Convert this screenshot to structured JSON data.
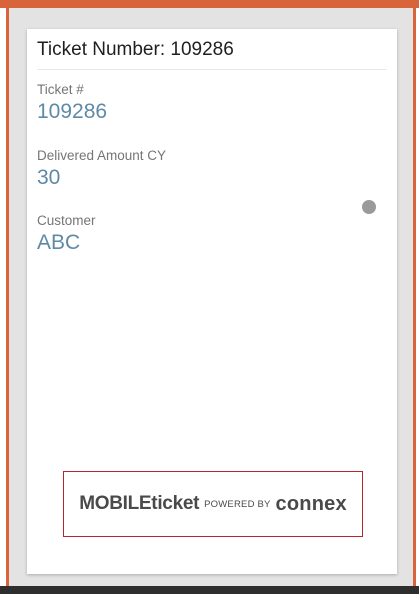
{
  "card": {
    "title": "Ticket Number: 109286"
  },
  "fields": [
    {
      "label": "Ticket #",
      "value": "109286"
    },
    {
      "label": "Delivered Amount CY",
      "value": "30"
    },
    {
      "label": "Customer",
      "value": "ABC"
    }
  ],
  "logo": {
    "product": "MOBILEticket",
    "powered_by": "POWERED BY",
    "brand": "connex"
  },
  "colors": {
    "accent_border": "#d9643c",
    "value_text": "#5e8aa5",
    "logo_box_border": "#b3262d"
  }
}
